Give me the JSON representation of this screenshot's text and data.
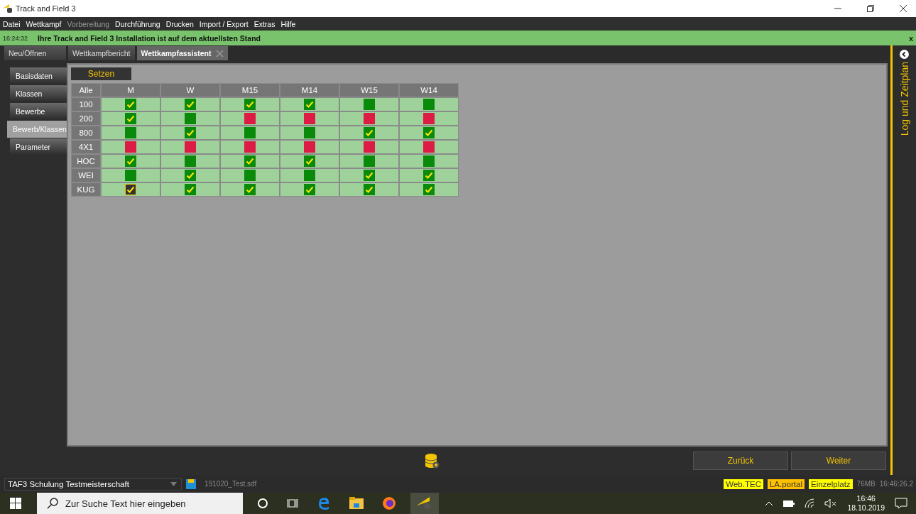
{
  "window": {
    "title": "Track and Field 3"
  },
  "menu": [
    {
      "label": "Datei",
      "disabled": false
    },
    {
      "label": "Wettkampf",
      "disabled": false
    },
    {
      "label": "Vorbereitung",
      "disabled": true
    },
    {
      "label": "Durchführung",
      "disabled": false
    },
    {
      "label": "Drucken",
      "disabled": false
    },
    {
      "label": "Import / Export",
      "disabled": false
    },
    {
      "label": "Extras",
      "disabled": false
    },
    {
      "label": "Hilfe",
      "disabled": false
    }
  ],
  "notice": {
    "time": "16:24:32",
    "message": "Ihre Track and Field 3 Installation ist auf dem aktuellsten Stand",
    "close": "x"
  },
  "tabs": [
    {
      "label": "Neu/Öffnen",
      "selected": false
    },
    {
      "label": "Wettkampfbericht",
      "selected": false
    },
    {
      "label": "Wettkampfassistent",
      "selected": true
    }
  ],
  "side_tabs": [
    {
      "label": "Basisdaten",
      "selected": false
    },
    {
      "label": "Klassen",
      "selected": false
    },
    {
      "label": "Bewerbe",
      "selected": false
    },
    {
      "label": "Bewerb/Klassen",
      "selected": true
    },
    {
      "label": "Parameter",
      "selected": false
    }
  ],
  "set_button": "Setzen",
  "table": {
    "corner": "Alle",
    "columns": [
      "M",
      "W",
      "M15",
      "M14",
      "W15",
      "W14"
    ],
    "rows": [
      {
        "label": "100",
        "cells": [
          {
            "enabled": true,
            "checked": true,
            "focused": false
          },
          {
            "enabled": true,
            "checked": true,
            "focused": false
          },
          {
            "enabled": true,
            "checked": true,
            "focused": false
          },
          {
            "enabled": true,
            "checked": true,
            "focused": false
          },
          {
            "enabled": true,
            "checked": false,
            "focused": false
          },
          {
            "enabled": true,
            "checked": false,
            "focused": false
          }
        ]
      },
      {
        "label": "200",
        "cells": [
          {
            "enabled": true,
            "checked": true,
            "focused": false
          },
          {
            "enabled": true,
            "checked": false,
            "focused": false
          },
          {
            "enabled": false,
            "checked": false,
            "focused": false
          },
          {
            "enabled": false,
            "checked": false,
            "focused": false
          },
          {
            "enabled": false,
            "checked": false,
            "focused": false
          },
          {
            "enabled": false,
            "checked": false,
            "focused": false
          }
        ]
      },
      {
        "label": "800",
        "cells": [
          {
            "enabled": true,
            "checked": false,
            "focused": false
          },
          {
            "enabled": true,
            "checked": true,
            "focused": false
          },
          {
            "enabled": true,
            "checked": false,
            "focused": false
          },
          {
            "enabled": true,
            "checked": false,
            "focused": false
          },
          {
            "enabled": true,
            "checked": true,
            "focused": false
          },
          {
            "enabled": true,
            "checked": true,
            "focused": false
          }
        ]
      },
      {
        "label": "4X1",
        "cells": [
          {
            "enabled": false,
            "checked": false,
            "focused": false
          },
          {
            "enabled": false,
            "checked": false,
            "focused": false
          },
          {
            "enabled": false,
            "checked": false,
            "focused": false
          },
          {
            "enabled": false,
            "checked": false,
            "focused": false
          },
          {
            "enabled": false,
            "checked": false,
            "focused": false
          },
          {
            "enabled": false,
            "checked": false,
            "focused": false
          }
        ]
      },
      {
        "label": "HOC",
        "cells": [
          {
            "enabled": true,
            "checked": true,
            "focused": false
          },
          {
            "enabled": true,
            "checked": false,
            "focused": false
          },
          {
            "enabled": true,
            "checked": true,
            "focused": false
          },
          {
            "enabled": true,
            "checked": true,
            "focused": false
          },
          {
            "enabled": true,
            "checked": false,
            "focused": false
          },
          {
            "enabled": true,
            "checked": false,
            "focused": false
          }
        ]
      },
      {
        "label": "WEI",
        "cells": [
          {
            "enabled": true,
            "checked": false,
            "focused": false
          },
          {
            "enabled": true,
            "checked": true,
            "focused": false
          },
          {
            "enabled": true,
            "checked": false,
            "focused": false
          },
          {
            "enabled": true,
            "checked": false,
            "focused": false
          },
          {
            "enabled": true,
            "checked": true,
            "focused": false
          },
          {
            "enabled": true,
            "checked": true,
            "focused": false
          }
        ]
      },
      {
        "label": "KUG",
        "cells": [
          {
            "enabled": true,
            "checked": true,
            "focused": true
          },
          {
            "enabled": true,
            "checked": true,
            "focused": false
          },
          {
            "enabled": true,
            "checked": true,
            "focused": false
          },
          {
            "enabled": true,
            "checked": true,
            "focused": false
          },
          {
            "enabled": true,
            "checked": true,
            "focused": false
          },
          {
            "enabled": true,
            "checked": true,
            "focused": false
          }
        ]
      }
    ]
  },
  "nav_buttons": [
    "Zurück",
    "Weiter"
  ],
  "side_panel": {
    "label": "Log und Zeitplan"
  },
  "status_bar": {
    "competition": "TAF3 Schulung Testmeisterschaft",
    "file": "191020_Test.sdf",
    "badges": [
      {
        "label": "Web.TEC",
        "color": "#ffff00"
      },
      {
        "label": "LA.portal",
        "color": "#ffc000"
      },
      {
        "label": "Einzelplatz",
        "color": "#ffff00"
      }
    ],
    "memory": "76MB",
    "clock": "16:46:26.2"
  },
  "taskbar": {
    "search_placeholder": "Zur Suche Text hier eingeben",
    "time": "16:46",
    "date": "18.10.2019"
  }
}
